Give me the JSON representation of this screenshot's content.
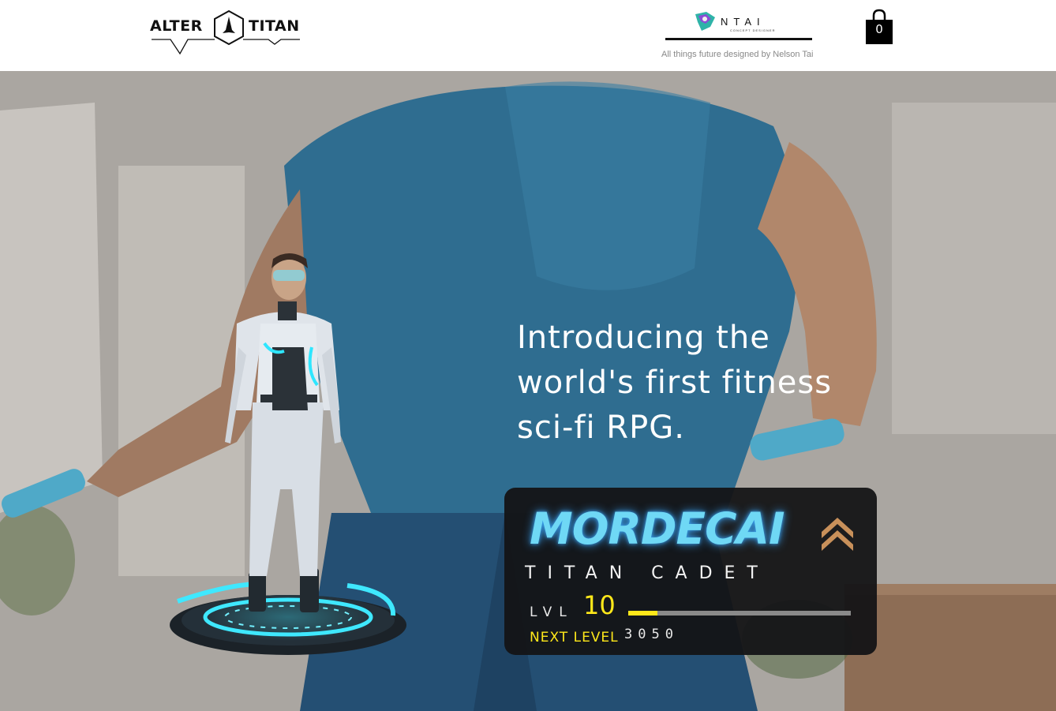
{
  "header": {
    "logo": {
      "left_word": "ALTER",
      "right_word": "TITAN"
    },
    "partner": {
      "name": "NTAI",
      "subtitle": "CONCEPT DESIGNER"
    },
    "tagline": "All things future designed by Nelson Tai",
    "cart": {
      "icon": "shopping-bag-icon",
      "count": "0"
    }
  },
  "hero": {
    "title": "Introducing the world's first fitness sci-fi RPG."
  },
  "profile_card": {
    "name": "MORDECAI",
    "rank_icon": "double-chevron-up-icon",
    "class": "TITAN CADET",
    "level_label": "LVL",
    "level": "10",
    "xp_progress": 0.13,
    "next_level_label": "NEXT LEVEL",
    "next_level_value": "3050"
  },
  "colors": {
    "name_glow": "#6fd8f5",
    "accent_yellow": "#ffe81a",
    "rank_gold": "#c8905a",
    "card_bg": "#141416",
    "suit_glow": "#2ee6ff"
  }
}
